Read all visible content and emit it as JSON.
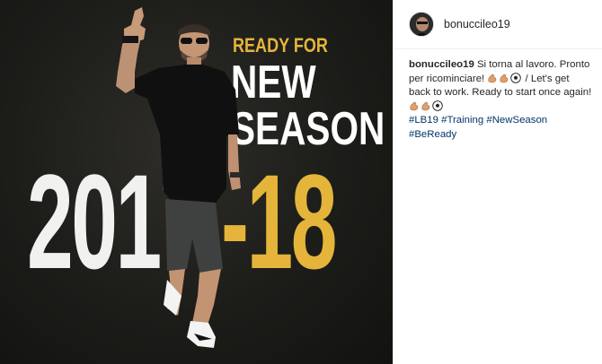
{
  "media": {
    "headline_small": "READY FOR",
    "headline_line1": "NEW",
    "headline_line2": "SEASON",
    "year_left": "2017",
    "year_right": "-18",
    "colors": {
      "background": "#1c1c19",
      "gold": "#e4b53a",
      "white": "#ffffff"
    }
  },
  "post": {
    "username": "bonuccileo19",
    "caption": {
      "author": "bonuccileo19",
      "text_part1": " Si torna al lavoro. Pronto per ricominciare! ",
      "emojis_1": [
        "flexed-biceps-icon",
        "flexed-biceps-icon",
        "soccer-ball-icon"
      ],
      "text_part2": " / Let's get back to work. Ready to start once again! ",
      "emojis_2": [
        "flexed-biceps-icon",
        "flexed-biceps-icon",
        "soccer-ball-icon"
      ],
      "hashtags": [
        "#LB19",
        "#Training",
        "#NewSeason",
        "#BeReady"
      ]
    },
    "colors": {
      "hashtag": "#003569",
      "text": "#262626",
      "border": "#efefef"
    }
  }
}
